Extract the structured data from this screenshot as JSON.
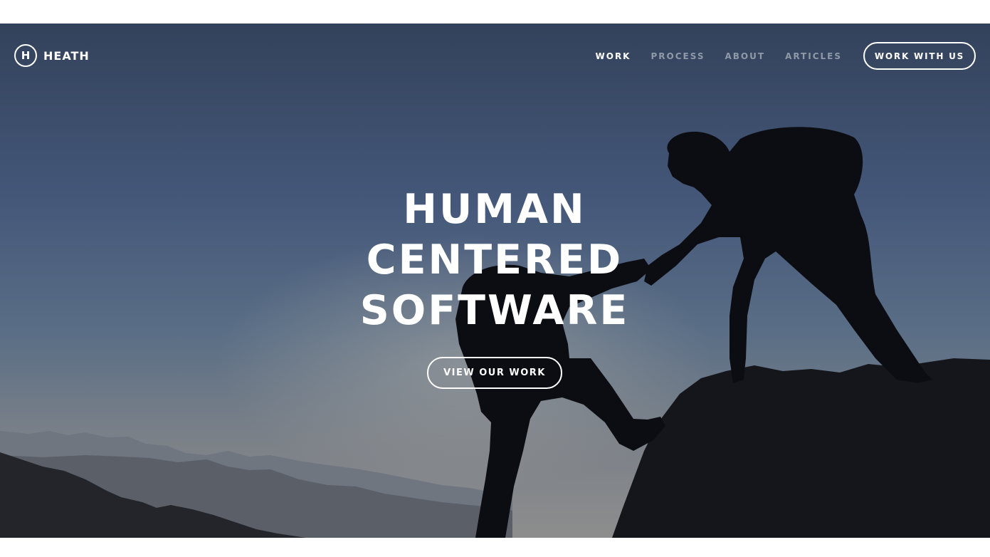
{
  "brand": {
    "logo_letter": "H",
    "name": "HEATH"
  },
  "nav": {
    "items": [
      {
        "label": "WORK",
        "active": true
      },
      {
        "label": "PROCESS",
        "active": false
      },
      {
        "label": "ABOUT",
        "active": false
      },
      {
        "label": "ARTICLES",
        "active": false
      }
    ],
    "cta_label": "WORK WITH US"
  },
  "hero": {
    "headline_lines": [
      "HUMAN",
      "CENTERED",
      "SOFTWARE"
    ],
    "cta_label": "VIEW OUR WORK",
    "background_image": "silhouette-of-two-climbers-helping-each-other-on-mountain-at-dusk",
    "colors": {
      "sky_top": "#34435c",
      "sky_mid": "#54677f",
      "sky_horizon": "#8a8c8e",
      "silhouette": "#0c0d12",
      "text": "#ffffff",
      "nav_inactive": "#8f99a8"
    }
  }
}
